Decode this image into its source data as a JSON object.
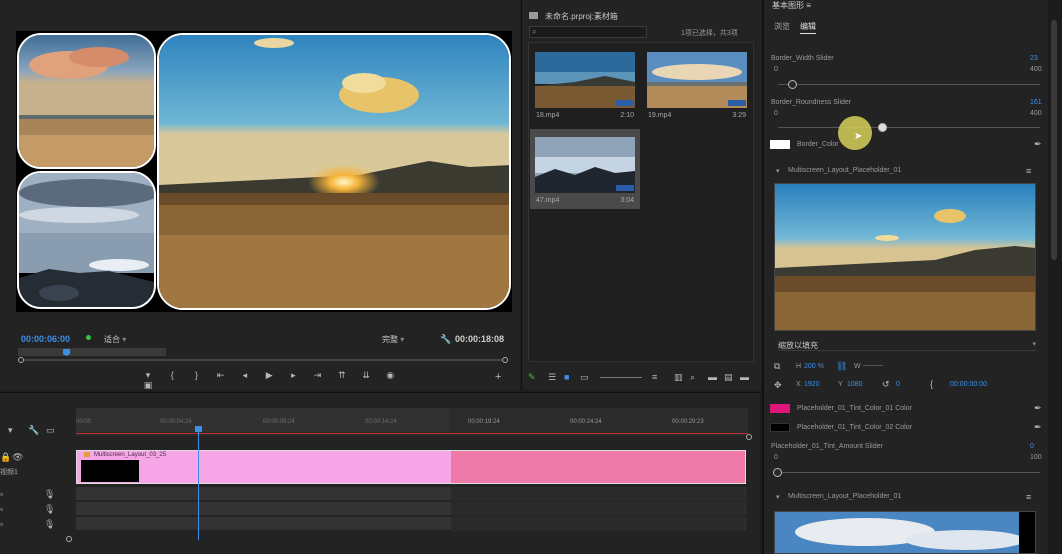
{
  "colors": {
    "accent": "#3d8ee6",
    "clip_pink": "#f6a6e6",
    "clip_magenta": "#ee7aa8",
    "tint_color_01": "#e0157a",
    "tint_color_02": "#000000",
    "border_color": "#ffffff",
    "cursor_highlight": "#d6d05a"
  },
  "program": {
    "timecode_current": "00:00:06:00",
    "fit_dropdown": "适合",
    "quality_dropdown": "完整",
    "timecode_total": "00:00:18:08",
    "transport_icons": [
      "marker-icon",
      "in-point-icon",
      "out-point-icon",
      "go-to-in-icon",
      "step-back-icon",
      "play-icon",
      "step-forward-icon",
      "go-to-out-icon",
      "lift-icon",
      "extract-icon",
      "export-frame-icon",
      "compare-icon",
      "add-icon"
    ]
  },
  "project": {
    "title": "未命名.prproj:素材箱",
    "selection_count": "1项已选择，共3项",
    "clips": [
      {
        "name": "18.mp4",
        "duration": "2:10"
      },
      {
        "name": "19.mp4",
        "duration": "3:29"
      },
      {
        "name": "47.mp4",
        "duration": "3:04"
      }
    ]
  },
  "effects": {
    "header": "基本图形 ≡",
    "tab_video": "浏览",
    "tab_edit": "编辑",
    "border_width": {
      "label": "Border_Width Slider",
      "value": "23",
      "min": "0",
      "max": "400",
      "level": 0.058
    },
    "border_roundness": {
      "label": "Border_Roundness Slider",
      "value": "161",
      "min": "0",
      "max": "400",
      "level": 0.4
    },
    "border_color_label": "Border_Color",
    "placeholder1_title": "Multiscreen_Layout_Placeholder_01",
    "fill_mode": "缩放以填充",
    "h_label": "H",
    "h_value": "200 %",
    "w_label": "W",
    "x_label": "X",
    "x_value": "1920",
    "y_label": "Y",
    "y_value": "1080",
    "rotation_value": "0",
    "time_value": "00:00:00:00",
    "tint1_label": "Placeholder_01_Tint_Color_01 Color",
    "tint2_label": "Placeholder_01_Tint_Color_02 Color",
    "tint_amount": {
      "label": "Placeholder_01_Tint_Amount Slider",
      "value": "0",
      "min": "0",
      "max": "100",
      "level": 0.0
    },
    "placeholder2_title": "Multiscreen_Layout_Placeholder_01"
  },
  "timeline": {
    "ticks": [
      "00:00",
      "00:00:04:24",
      "00:00:09:24",
      "00:00:14:24",
      "00:00:19:24",
      "00:00:24:24",
      "00:00:29:23"
    ],
    "clip_name": "Multiscreen_Layout_03_25",
    "track_v1": "视频1"
  }
}
